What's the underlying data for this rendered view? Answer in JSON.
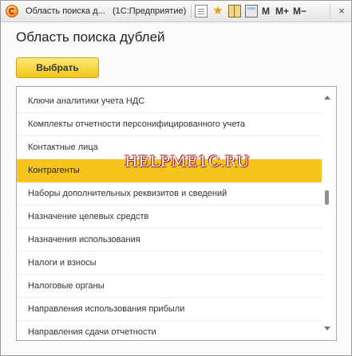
{
  "window": {
    "title": "Область поиска д...",
    "app": "(1С:Предприятие)",
    "buttons": {
      "minimize": "M",
      "maximize": "M+",
      "restore": "M−",
      "close": "×"
    }
  },
  "icons": [
    "page-icon",
    "star-icon",
    "book-icon",
    "calculator-icon"
  ],
  "form": {
    "heading": "Область поиска дублей",
    "select_button": "Выбрать"
  },
  "list": {
    "items": [
      "Ключи аналитики учета НДС",
      "Комплекты отчетности персонифицированного учета",
      "Контактные лица",
      "Контрагенты",
      "Наборы дополнительных реквизитов и сведений",
      "Назначение целевых средств",
      "Назначения использования",
      "Налоги и взносы",
      "Налоговые органы",
      "Направления использования прибыли",
      "Направления сдачи отчетности"
    ],
    "selected_index": 3
  },
  "watermark": "HELPME1C.RU",
  "colors": {
    "selection": "#f5c51d",
    "button": "#f3c718"
  }
}
